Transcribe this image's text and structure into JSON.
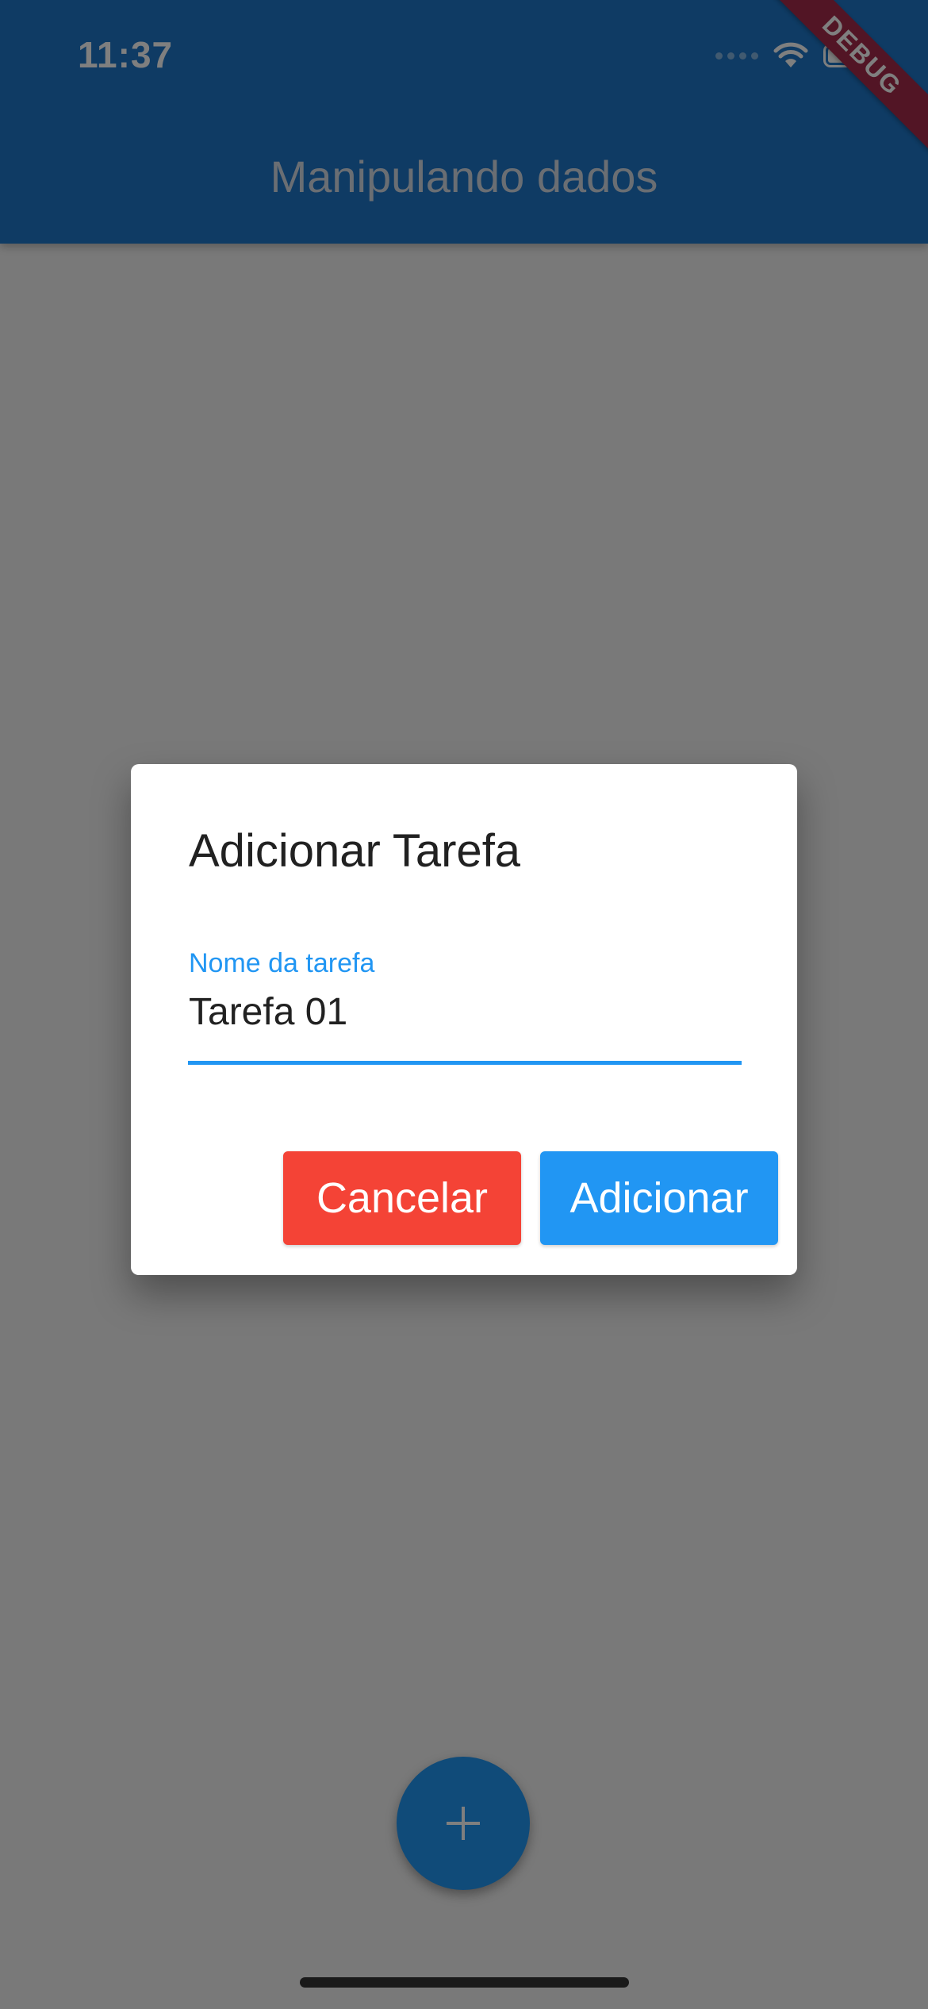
{
  "status_bar": {
    "time": "11:37",
    "icons": [
      "signal-dots-icon",
      "wifi-icon",
      "battery-icon"
    ]
  },
  "app_bar": {
    "title": "Manipulando dados",
    "background_color": "#1e77c9"
  },
  "debug_banner": {
    "text": "DEBUG",
    "color": "#a52a4a"
  },
  "dialog": {
    "title": "Adicionar Tarefa",
    "field": {
      "label": "Nome da tarefa",
      "value": "Tarefa 01"
    },
    "buttons": {
      "cancel_label": "Cancelar",
      "cancel_color": "#f44336",
      "add_label": "Adicionar",
      "add_color": "#2196f3"
    }
  },
  "fab": {
    "icon": "plus-icon"
  }
}
